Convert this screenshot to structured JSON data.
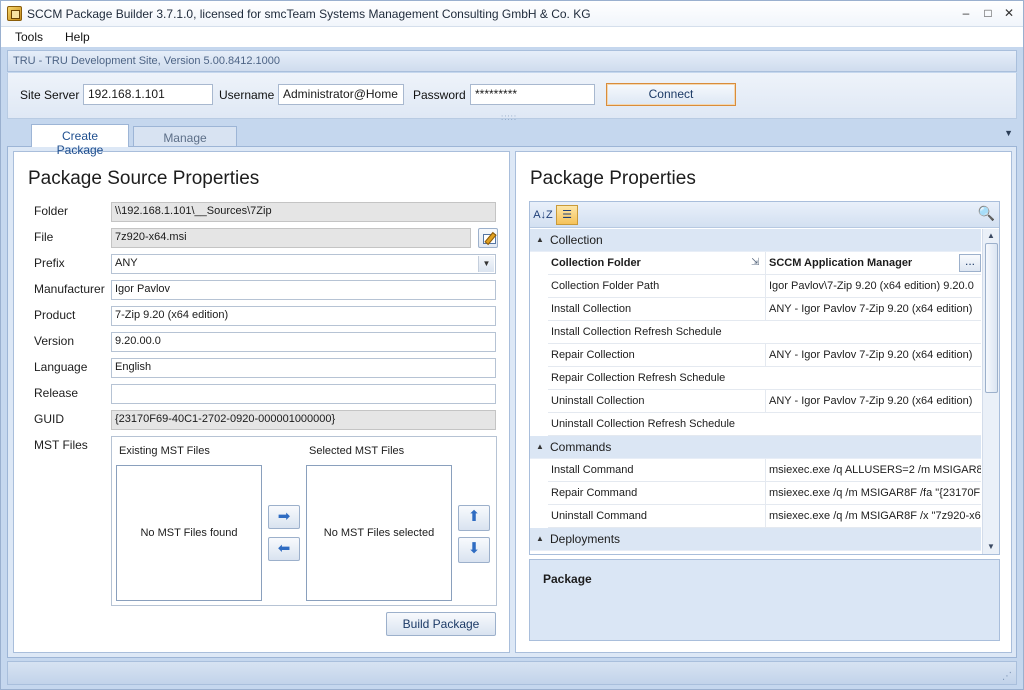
{
  "window": {
    "title": "SCCM Package Builder 3.7.1.0, licensed for smcTeam Systems Management Consulting GmbH & Co. KG",
    "controls": {
      "minimize": "–",
      "maximize": "□",
      "close": "✕"
    }
  },
  "menu": {
    "items": [
      "Tools",
      "Help"
    ]
  },
  "site_info": "TRU - TRU Development Site, Version 5.00.8412.1000",
  "connection": {
    "site_server_label": "Site Server",
    "site_server_value": "192.168.1.101",
    "username_label": "Username",
    "username_value": "Administrator@Home",
    "password_label": "Password",
    "password_value": "*********",
    "connect_label": "Connect"
  },
  "tabs": {
    "active": "Create Package",
    "inactive": "Manage Package"
  },
  "source": {
    "title": "Package Source Properties",
    "fields": {
      "folder": {
        "label": "Folder",
        "value": "\\\\192.168.1.101\\__Sources\\7Zip"
      },
      "file": {
        "label": "File",
        "value": "7z920-x64.msi"
      },
      "prefix": {
        "label": "Prefix",
        "value": "ANY"
      },
      "manufacturer": {
        "label": "Manufacturer",
        "value": "Igor Pavlov"
      },
      "product": {
        "label": "Product",
        "value": "7-Zip 9.20 (x64 edition)"
      },
      "version": {
        "label": "Version",
        "value": "9.20.00.0"
      },
      "language": {
        "label": "Language",
        "value": "English"
      },
      "release": {
        "label": "Release",
        "value": ""
      },
      "guid": {
        "label": "GUID",
        "value": "{23170F69-40C1-2702-0920-000001000000}"
      }
    },
    "mst": {
      "label": "MST Files",
      "existing_header": "Existing MST Files",
      "selected_header": "Selected MST Files",
      "existing_empty": "No MST Files found",
      "selected_empty": "No MST Files selected"
    },
    "build_label": "Build Package"
  },
  "properties": {
    "title": "Package Properties",
    "toolbar": {
      "sort_alpha": "A↓Z",
      "categorized": "☰",
      "search_icon": "search-icon"
    },
    "categories": [
      {
        "name": "Collection",
        "rows": [
          {
            "name": "Collection Folder",
            "value": "SCCM Application Manager",
            "selected": true
          },
          {
            "name": "Collection Folder Path",
            "value": "Igor Pavlov\\7-Zip 9.20 (x64 edition) 9.20.0"
          },
          {
            "name": "Install Collection",
            "value": "ANY - Igor Pavlov 7-Zip 9.20 (x64 edition)"
          },
          {
            "name": "Install Collection Refresh Schedule",
            "value": ""
          },
          {
            "name": "Repair Collection",
            "value": "ANY - Igor Pavlov 7-Zip 9.20 (x64 edition)"
          },
          {
            "name": "Repair Collection Refresh Schedule",
            "value": ""
          },
          {
            "name": "Uninstall Collection",
            "value": "ANY - Igor Pavlov 7-Zip 9.20 (x64 edition)"
          },
          {
            "name": "Uninstall Collection Refresh Schedule",
            "value": ""
          }
        ]
      },
      {
        "name": "Commands",
        "rows": [
          {
            "name": "Install Command",
            "value": "msiexec.exe /q ALLUSERS=2 /m MSIGAR8"
          },
          {
            "name": "Repair Command",
            "value": "msiexec.exe /q /m MSIGAR8F /fa \"{23170F"
          },
          {
            "name": "Uninstall Command",
            "value": "msiexec.exe /q /m MSIGAR8F /x \"7z920-x6"
          }
        ]
      },
      {
        "name": "Deployments",
        "rows": []
      }
    ],
    "description_title": "Package"
  },
  "colors": {
    "accent": "#1f4f8f",
    "connect_border": "#d98c3a",
    "panel_bg": "#dde8f6"
  }
}
